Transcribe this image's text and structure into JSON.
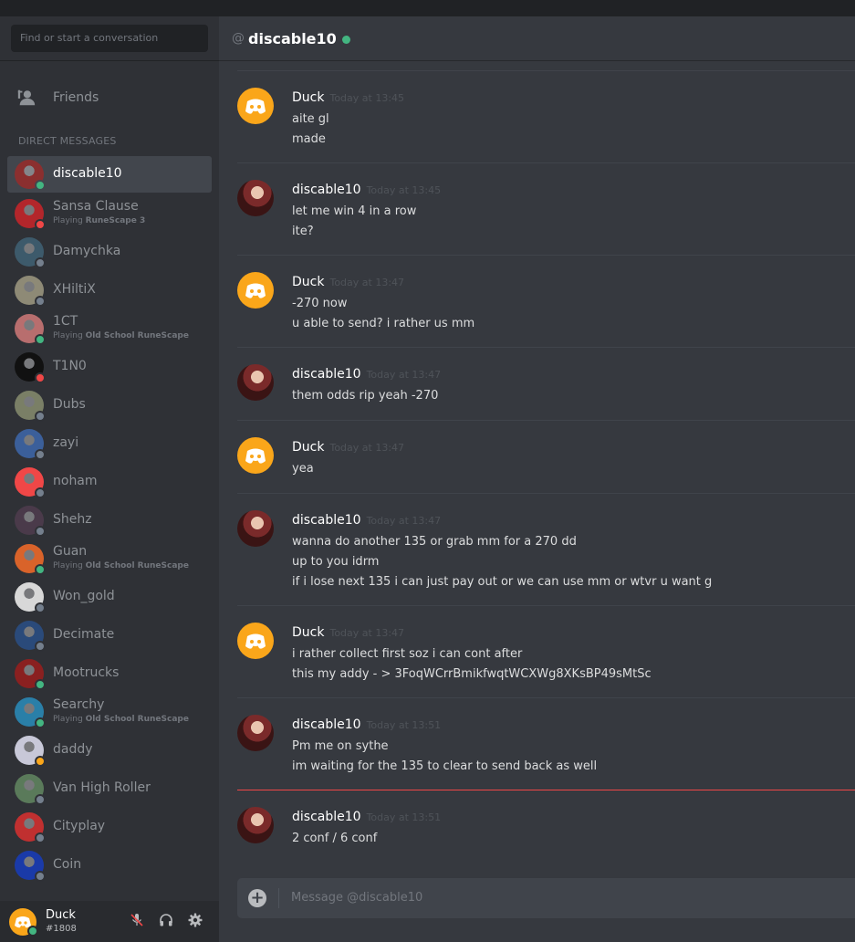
{
  "search": {
    "placeholder": "Find or start a conversation"
  },
  "nav": {
    "friends_label": "Friends",
    "dm_header": "DIRECT MESSAGES"
  },
  "colors": {
    "online": "#43b581",
    "dnd": "#f04747",
    "idle": "#faa61a",
    "offline": "#747f8d",
    "accent": "#7289da"
  },
  "dms": [
    {
      "name": "discable10",
      "status": "online",
      "active": true,
      "avatar_color": "#8b2f2f"
    },
    {
      "name": "Sansa Clause",
      "status": "dnd",
      "activity_prefix": "Playing",
      "activity": "RuneScape 3",
      "avatar_color": "#b3262b"
    },
    {
      "name": "Damychka",
      "status": "offline",
      "avatar_color": "#3d5a6b"
    },
    {
      "name": "XHiltiX",
      "status": "offline",
      "avatar_color": "#8e8a76"
    },
    {
      "name": "1CT",
      "status": "online",
      "activity_prefix": "Playing",
      "activity": "Old School RuneScape",
      "avatar_color": "#b86e6e"
    },
    {
      "name": "T1N0",
      "status": "dnd",
      "avatar_color": "#111111"
    },
    {
      "name": "Dubs",
      "status": "offline",
      "avatar_color": "#7a7f66"
    },
    {
      "name": "zayi",
      "status": "offline",
      "avatar_color": "#3b5f9a"
    },
    {
      "name": "noham",
      "status": "offline",
      "avatar_color": "#f04747"
    },
    {
      "name": "Shehz",
      "status": "offline",
      "avatar_color": "#4a3a4a"
    },
    {
      "name": "Guan",
      "status": "online",
      "activity_prefix": "Playing",
      "activity": "Old School RuneScape",
      "avatar_color": "#d9632a"
    },
    {
      "name": "Won_gold",
      "status": "offline",
      "avatar_color": "#d8d8d8"
    },
    {
      "name": "Decimate",
      "status": "offline",
      "avatar_color": "#2a4a7a"
    },
    {
      "name": "Mootrucks",
      "status": "online",
      "avatar_color": "#8a2020"
    },
    {
      "name": "Searchy",
      "status": "online",
      "activity_prefix": "Playing",
      "activity": "Old School RuneScape",
      "avatar_color": "#2a7fa8"
    },
    {
      "name": "daddy",
      "status": "idle",
      "avatar_color": "#c8c8d8"
    },
    {
      "name": "Van High Roller",
      "status": "offline",
      "avatar_color": "#5a7a5a"
    },
    {
      "name": "Cityplay",
      "status": "offline",
      "avatar_color": "#c03030"
    },
    {
      "name": "Coin",
      "status": "offline",
      "avatar_color": "#1a3aa8"
    }
  ],
  "user": {
    "name": "Duck",
    "tag": "#1808"
  },
  "chat": {
    "at": "@",
    "recipient": "discable10"
  },
  "messages": [
    {
      "author": "Duck",
      "time": "Today at 13:45",
      "avatar": "duck",
      "lines": [
        "aite gl",
        "made"
      ]
    },
    {
      "author": "discable10",
      "time": "Today at 13:45",
      "avatar": "disc",
      "lines": [
        "let me win 4 in a row",
        "ite?"
      ]
    },
    {
      "author": "Duck",
      "time": "Today at 13:47",
      "avatar": "duck",
      "lines": [
        "-270 now",
        "u able to send? i rather us mm"
      ]
    },
    {
      "author": "discable10",
      "time": "Today at 13:47",
      "avatar": "disc",
      "lines": [
        "them odds rip yeah -270"
      ]
    },
    {
      "author": "Duck",
      "time": "Today at 13:47",
      "avatar": "duck",
      "lines": [
        "yea"
      ]
    },
    {
      "author": "discable10",
      "time": "Today at 13:47",
      "avatar": "disc",
      "lines": [
        "wanna do another 135 or grab mm for a 270 dd",
        "up to you idrm",
        "if i lose next 135 i can just pay out or we can use mm or wtvr u want g"
      ]
    },
    {
      "author": "Duck",
      "time": "Today at 13:47",
      "avatar": "duck",
      "lines": [
        "i rather collect first soz i can cont after",
        "this my addy - > 3FoqWCrrBmikfwqtWCXWg8XKsBP49sMtSc"
      ]
    },
    {
      "author": "discable10",
      "time": "Today at 13:51",
      "avatar": "disc",
      "lines": [
        "Pm me on sythe",
        "im waiting for the 135 to clear to send back as well"
      ]
    },
    {
      "author": "discable10",
      "time": "Today at 13:51",
      "avatar": "disc",
      "lines": [
        "2 conf / 6 conf"
      ],
      "new": true
    }
  ],
  "composer": {
    "placeholder": "Message @discable10"
  }
}
